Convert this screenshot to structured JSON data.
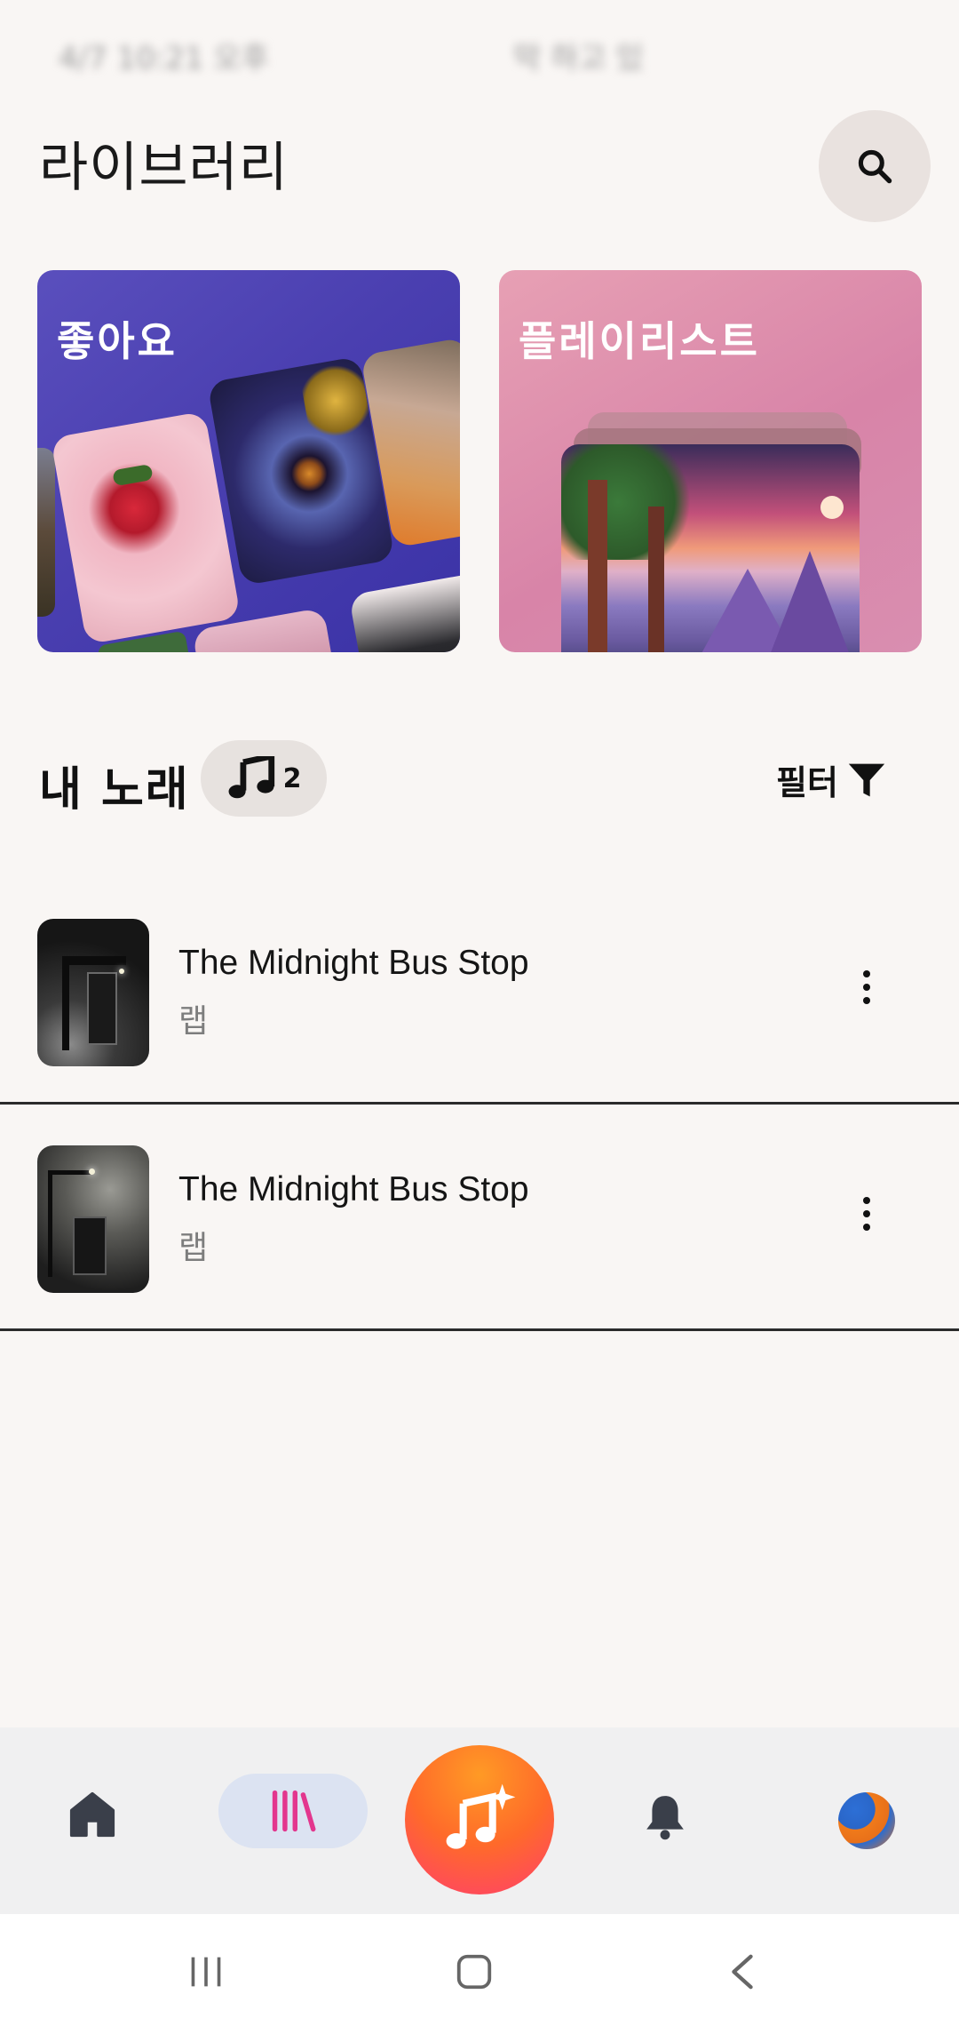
{
  "status_bar": {
    "time": "4/7 10:21 오후",
    "network": "막 하고 있"
  },
  "header": {
    "title": "라이브러리",
    "search_icon": "search-icon"
  },
  "cards": [
    {
      "title": "좋아요"
    },
    {
      "title": "플레이리스트"
    }
  ],
  "my_songs": {
    "title": "내 노래",
    "count": "2",
    "count_icon": "music-note-icon",
    "filter_label": "필터",
    "filter_icon": "filter-icon"
  },
  "songs": [
    {
      "title": "The Midnight Bus Stop",
      "genre": "랩"
    },
    {
      "title": "The Midnight Bus Stop",
      "genre": "랩"
    }
  ],
  "bottom_nav": {
    "items": [
      "home-icon",
      "library-icon",
      "create-music-icon",
      "bell-icon",
      "avatar"
    ],
    "active": "library",
    "accent": "#ff5a3a"
  },
  "system_nav": [
    "recents-icon",
    "home-icon",
    "back-icon"
  ]
}
